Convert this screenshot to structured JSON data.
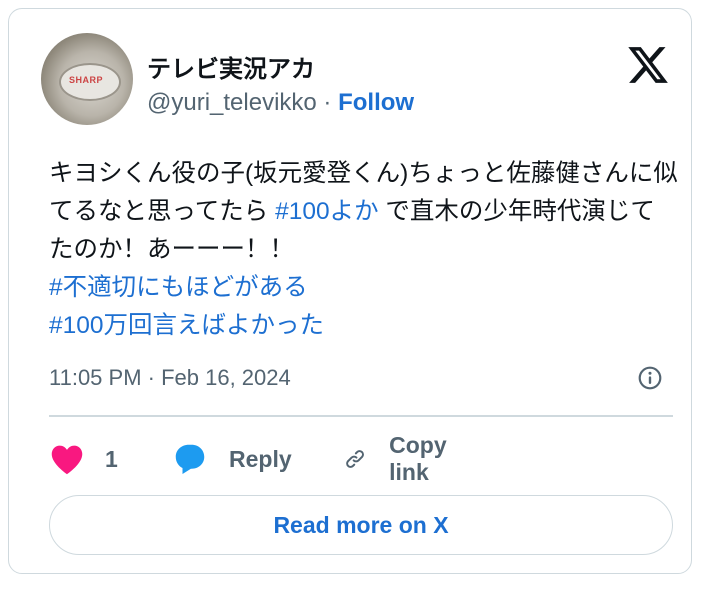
{
  "author": {
    "display_name": "テレビ実況アカ",
    "handle": "@yuri_televikko",
    "separator": " · ",
    "follow_label": "Follow",
    "avatar_sign_text": "SHARP"
  },
  "tweet": {
    "text_before_tag": "キヨシくん役の子(坂元愛登くん)ちょっと佐藤健さんに似てるなと思ってたら ",
    "inline_hashtag": "#100よか",
    "text_after_tag": " で直木の少年時代演じてたのか！あーーー！！",
    "hashtags": [
      "#不適切にもほどがある",
      "#100万回言えばよかった"
    ],
    "timestamp": "11:05 PM · Feb 16, 2024"
  },
  "actions": {
    "like_count": "1",
    "reply_label": "Reply",
    "copy_label": "Copy link"
  },
  "read_more_label": "Read more on X",
  "icons": {
    "logo": "x-logo-icon",
    "info": "info-icon",
    "like": "heart-icon",
    "reply": "speech-bubble-icon",
    "copy": "link-icon"
  },
  "colors": {
    "link": "#1d6fd1",
    "heart": "#f91880",
    "reply_bubble": "#1d9bf0",
    "secondary_text": "#536471",
    "border": "#cfd9de"
  }
}
